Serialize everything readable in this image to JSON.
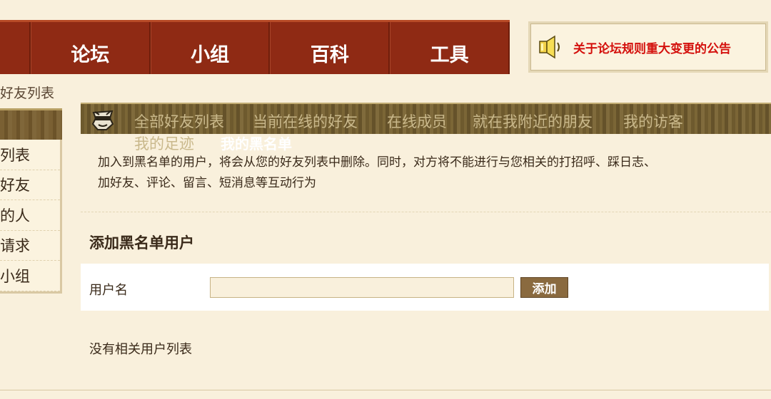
{
  "nav": {
    "items": [
      {
        "label": "论坛"
      },
      {
        "label": "小组"
      },
      {
        "label": "百科"
      },
      {
        "label": "工具"
      }
    ]
  },
  "notice": {
    "icon": "speaker-icon",
    "text": "关于论坛规则重大变更的公告"
  },
  "breadcrumb": "好友列表",
  "sidebar": {
    "items": [
      {
        "label": "列表"
      },
      {
        "label": "好友"
      },
      {
        "label": "的人"
      },
      {
        "label": "请求"
      },
      {
        "label": "小组"
      }
    ]
  },
  "tabs": {
    "icon": "masked-avatar-icon",
    "items": [
      {
        "label": "全部好友列表",
        "active": false
      },
      {
        "label": "当前在线的好友",
        "active": false
      },
      {
        "label": "在线成员",
        "active": false
      },
      {
        "label": "就在我附近的朋友",
        "active": false
      },
      {
        "label": "我的访客",
        "active": false
      },
      {
        "label": "我的足迹",
        "active": false
      },
      {
        "label": "我的黑名单",
        "active": true
      }
    ]
  },
  "main": {
    "description_line1": "加入到黑名单的用户，将会从您的好友列表中删除。同时，对方将不能进行与您相关的打招呼、踩日志、",
    "description_line2": "加好友、评论、留言、短消息等互动行为",
    "add_title": "添加黑名单用户",
    "username_label": "用户名",
    "username_value": "",
    "add_button": "添加",
    "empty_text": "没有相关用户列表"
  },
  "colors": {
    "nav_bg": "#8f2a14",
    "page_bg": "#f9f0dc",
    "notice_text": "#d4100c",
    "tab_active": "#ffffff",
    "tab_inactive": "#c9b88b",
    "button_bg": "#8a6a3f"
  }
}
